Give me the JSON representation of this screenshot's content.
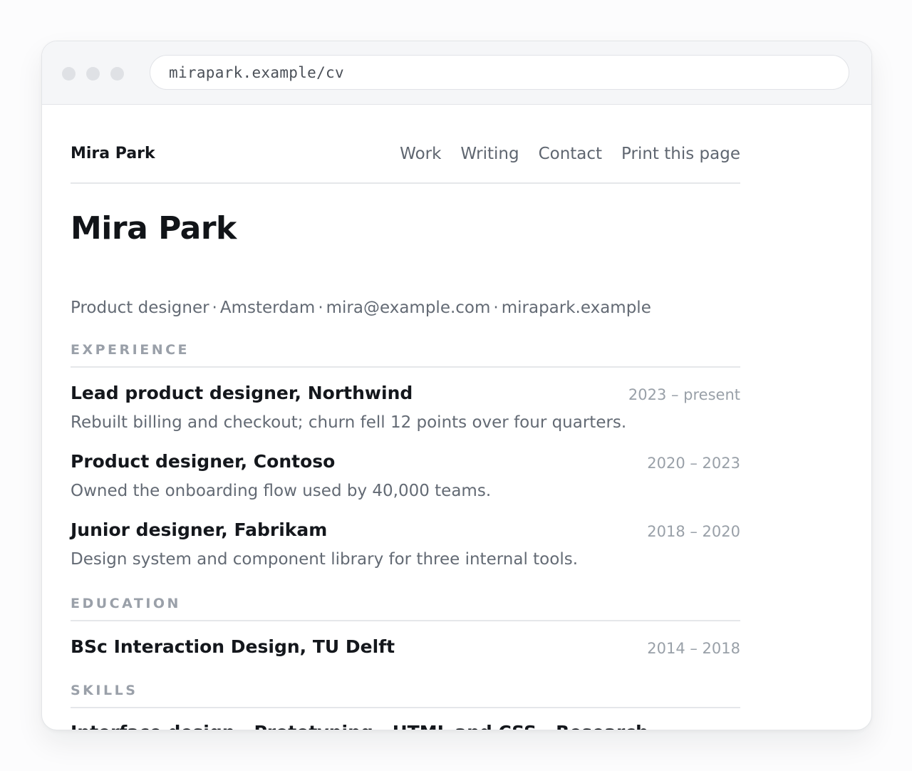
{
  "browser": {
    "url": "mirapark.example/cv"
  },
  "site_nav": {
    "brand": "Mira Park",
    "links": [
      "Work",
      "Writing",
      "Contact",
      "Print this page"
    ]
  },
  "header": {
    "name": "Mira Park",
    "tagline": {
      "role": "Product designer",
      "city": "Amsterdam",
      "email": "mira@example.com",
      "website": "mirapark.example",
      "separator": "·"
    }
  },
  "experience": {
    "heading": "EXPERIENCE",
    "items": [
      {
        "title": "Lead product designer, Northwind",
        "dates": "2023 – present",
        "description": "Rebuilt billing and checkout; churn fell 12 points over four quarters."
      },
      {
        "title": "Product designer, Contoso",
        "dates": "2020 – 2023",
        "description": "Owned the onboarding flow used by 40,000 teams."
      },
      {
        "title": "Junior designer, Fabrikam",
        "dates": "2018 – 2020",
        "description": "Design system and component library for three internal tools."
      }
    ]
  },
  "education": {
    "heading": "EDUCATION",
    "items": [
      {
        "title": "BSc Interaction Design, TU Delft",
        "dates": "2014 – 2018"
      }
    ]
  },
  "skills": {
    "heading": "SKILLS",
    "list": "Interface design · Prototyping · HTML and CSS · Research"
  },
  "colors": {
    "text_primary": "#14171c",
    "text_secondary": "#636a74",
    "text_muted": "#99a0a8",
    "section_heading": "#9aa0a9",
    "divider": "#e5e7ea",
    "chrome_bg": "#f5f6f8"
  }
}
